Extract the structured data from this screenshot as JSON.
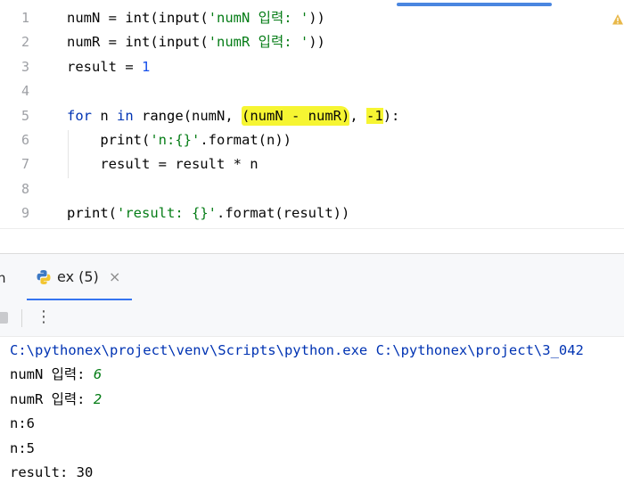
{
  "editor": {
    "lines": [
      {
        "n": "1",
        "t": [
          [
            "plain",
            "numN = "
          ],
          [
            "fn",
            "int"
          ],
          [
            "plain",
            "("
          ],
          [
            "fn",
            "input"
          ],
          [
            "plain",
            "("
          ],
          [
            "str",
            "'numN 입력: '"
          ],
          [
            "plain",
            "))"
          ]
        ]
      },
      {
        "n": "2",
        "t": [
          [
            "plain",
            "numR = "
          ],
          [
            "fn",
            "int"
          ],
          [
            "plain",
            "("
          ],
          [
            "fn",
            "input"
          ],
          [
            "plain",
            "("
          ],
          [
            "str",
            "'numR 입력: '"
          ],
          [
            "plain",
            "))"
          ]
        ]
      },
      {
        "n": "3",
        "t": [
          [
            "plain",
            "result = "
          ],
          [
            "num",
            "1"
          ]
        ]
      },
      {
        "n": "4",
        "t": []
      },
      {
        "n": "5",
        "t": [
          [
            "kw",
            "for"
          ],
          [
            "plain",
            " n "
          ],
          [
            "kw",
            "in"
          ],
          [
            "plain",
            " "
          ],
          [
            "fn",
            "range"
          ],
          [
            "plain",
            "(numN, "
          ],
          [
            "hla",
            "(numN - numR)"
          ],
          [
            "plain",
            ", "
          ],
          [
            "hlb",
            "-1"
          ],
          [
            "plain",
            "):"
          ]
        ]
      },
      {
        "n": "6",
        "t": [
          [
            "plain",
            "    "
          ],
          [
            "fn",
            "print"
          ],
          [
            "plain",
            "("
          ],
          [
            "str",
            "'n:{}'"
          ],
          [
            "plain",
            ".format(n))"
          ]
        ]
      },
      {
        "n": "7",
        "t": [
          [
            "plain",
            "    result = result * n"
          ]
        ]
      },
      {
        "n": "8",
        "t": []
      },
      {
        "n": "9",
        "t": [
          [
            "fn",
            "print"
          ],
          [
            "plain",
            "("
          ],
          [
            "str",
            "'result: {}'"
          ],
          [
            "plain",
            ".format(result))"
          ]
        ]
      }
    ]
  },
  "run_tab": {
    "cut_label": "n",
    "label": "ex (5)",
    "close": "×",
    "icon": "python-icon"
  },
  "toolbar": {
    "more": "⋮"
  },
  "console": {
    "lines": [
      {
        "type": "cmd",
        "parts": [
          [
            "cmd",
            "C:\\pythonex\\project\\venv\\Scripts\\python.exe C:\\pythonex\\project\\3_042"
          ]
        ]
      },
      {
        "type": "io",
        "parts": [
          [
            "plain",
            "numN 입력: "
          ],
          [
            "uin",
            "6"
          ]
        ]
      },
      {
        "type": "io",
        "parts": [
          [
            "plain",
            "numR 입력: "
          ],
          [
            "uin",
            "2"
          ]
        ]
      },
      {
        "type": "out",
        "parts": [
          [
            "plain",
            "n:6"
          ]
        ]
      },
      {
        "type": "out",
        "parts": [
          [
            "plain",
            "n:5"
          ]
        ]
      },
      {
        "type": "out",
        "parts": [
          [
            "plain",
            "result: 30"
          ]
        ]
      }
    ]
  },
  "colors": {
    "keyword": "#0033b3",
    "string": "#067d17",
    "number": "#1750eb",
    "highlight": "#f6f532",
    "accent": "#3574f0"
  }
}
